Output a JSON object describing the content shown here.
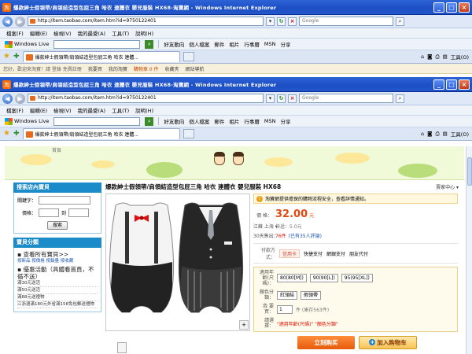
{
  "window": {
    "title": "爆款紳士假領帶/肩領結造型包屁三角 哈衣 連體衣 嬰兒服裝 HX68-淘寶網 - Windows Internet Explorer",
    "address": "http://item.taobao.com/item.htm?id=9750122401",
    "search_placeholder": "Google",
    "min": "_",
    "max": "□",
    "close": "×"
  },
  "menu": [
    "檔案(F)",
    "編輯(E)",
    "檢視(V)",
    "我的最愛(A)",
    "工具(T)",
    "說明(H)"
  ],
  "live": {
    "brand": "Windows Live",
    "links": [
      "好友動向",
      "個人檔案",
      "郵件",
      "相片",
      "行事曆",
      "MSN",
      "分享"
    ]
  },
  "tab": {
    "label": "爆款紳士假領帶/肩領結造型包屁三角 哈衣 連體..."
  },
  "toolbar_right": {
    "tools": "工具(O)"
  },
  "strip": {
    "left": "您好，歡迎來淘寶！請 登錄  免費註冊",
    "items": [
      "我要買",
      "我的淘寶",
      "購物車 0 件",
      "收藏夾",
      "網站導航"
    ]
  },
  "banner": {
    "tab_home": "首頁"
  },
  "sidebar": {
    "search_title": "搜索店內寶貝",
    "keyword_label": "關鍵字：",
    "price_label": "價格：",
    "to_label": "到",
    "search_button": "搜索",
    "category_title": "寶貝分類",
    "view_all": "查看所有寶貝>>",
    "view_links": "按新品 按價格 按銷量 按收藏",
    "promo_title": "優惠活動（具體看首頁，不循不送）",
    "promos": [
      "滿30元送活",
      "滿50元送活",
      "滿88元送禮物",
      "江浙滬滿180元外省滿158免包郵送禮物"
    ]
  },
  "product": {
    "title": "爆款紳士假領帶/肩領結造型包屁三角 哈衣 連體衣 嬰兒服裝 HX68",
    "center_link": "賣家中心 ▾",
    "notice": "淘寶網提供擔保的購物流程安全，查看詳情通知。",
    "notice_link": "查看詳情通知",
    "price_label": "價 格：",
    "price": "32.00",
    "price_unit": "元",
    "shipping_label": "江蘇 上海 ▾",
    "shipping_value": "快遞：5.0元",
    "sales_label": "30天售出：",
    "sales_value": "76件",
    "sales_extra": "(已有35人評論)",
    "pay_label": "付款方式：",
    "pay_methods": [
      "信用卡",
      "快捷支付",
      "網銀支付",
      "朋友代付"
    ],
    "size_label": "適用年齡(尺碼)：",
    "sizes": [
      "80(80[M])",
      "90(90[L])",
      "95(95[XL])"
    ],
    "color_label": "顏色分類：",
    "colors": [
      "紅領結",
      "假領帶"
    ],
    "qty_label": "我 要 買：",
    "qty_value": "1",
    "stock": "件 (庫存563件)",
    "choose_label": "請選擇：",
    "choose_hint": "\"適用年齡(尺碼)\" \"顏色分類\"",
    "buy_button": "立刻购买",
    "cart_button": "加入购物车",
    "zoom": "+"
  },
  "colors": {
    "titlebar": "#1b4fc4",
    "accent_orange": "#e4480f",
    "sidebar_blue": "#1c8bc9"
  }
}
